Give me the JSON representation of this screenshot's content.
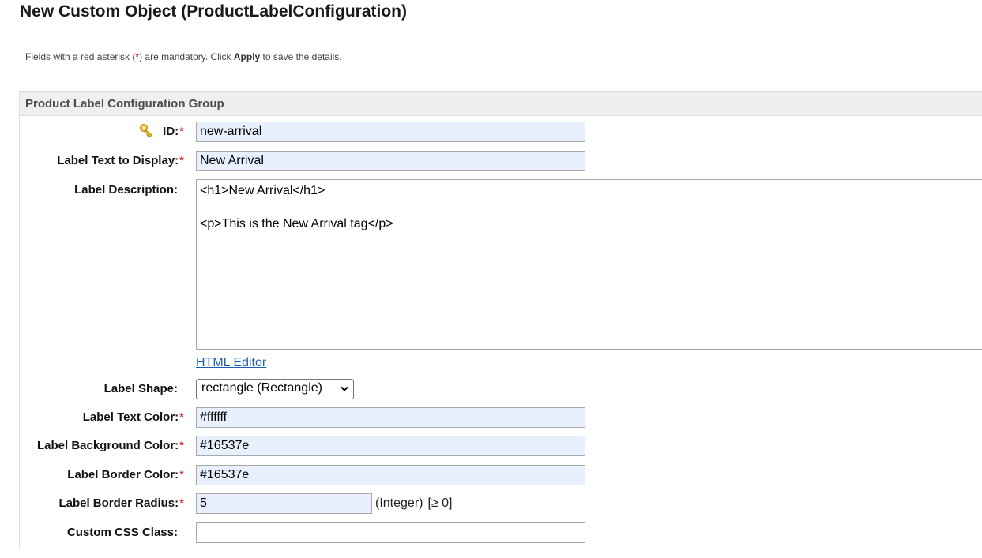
{
  "page": {
    "title": "New Custom Object (ProductLabelConfiguration)",
    "hint": {
      "before": "Fields with a red asterisk (",
      "asterisk": "*",
      "middle": ") are mandatory. Click ",
      "action": "Apply",
      "after": " to save the details."
    }
  },
  "group": {
    "title": "Product Label Configuration Group"
  },
  "required_marker": "*",
  "fields": {
    "id": {
      "label": "ID:",
      "value": "new-arrival",
      "icon": "key-icon"
    },
    "label_text": {
      "label": "Label Text to Display:",
      "value": "New Arrival"
    },
    "description": {
      "label": "Label Description:",
      "value": "<h1>New Arrival</h1>\n\n<p>This is the New Arrival tag</p>",
      "link": "HTML Editor"
    },
    "shape": {
      "label": "Label Shape:",
      "selected": "rectangle (Rectangle)"
    },
    "text_color": {
      "label": "Label Text Color:",
      "value": "#ffffff"
    },
    "background_color": {
      "label": "Label Background Color:",
      "value": "#16537e"
    },
    "border_color": {
      "label": "Label Border Color:",
      "value": "#16537e"
    },
    "border_radius": {
      "label": "Label Border Radius:",
      "value": "5",
      "type_hint": "(Integer)",
      "range_hint": "[≥ 0]"
    },
    "css_class": {
      "label": "Custom CSS Class:",
      "value": ""
    }
  },
  "colors": {
    "required": "#cc0000",
    "input_fill": "#e8f0fe",
    "header_bg": "#efefef",
    "link": "#1a5fb4"
  }
}
